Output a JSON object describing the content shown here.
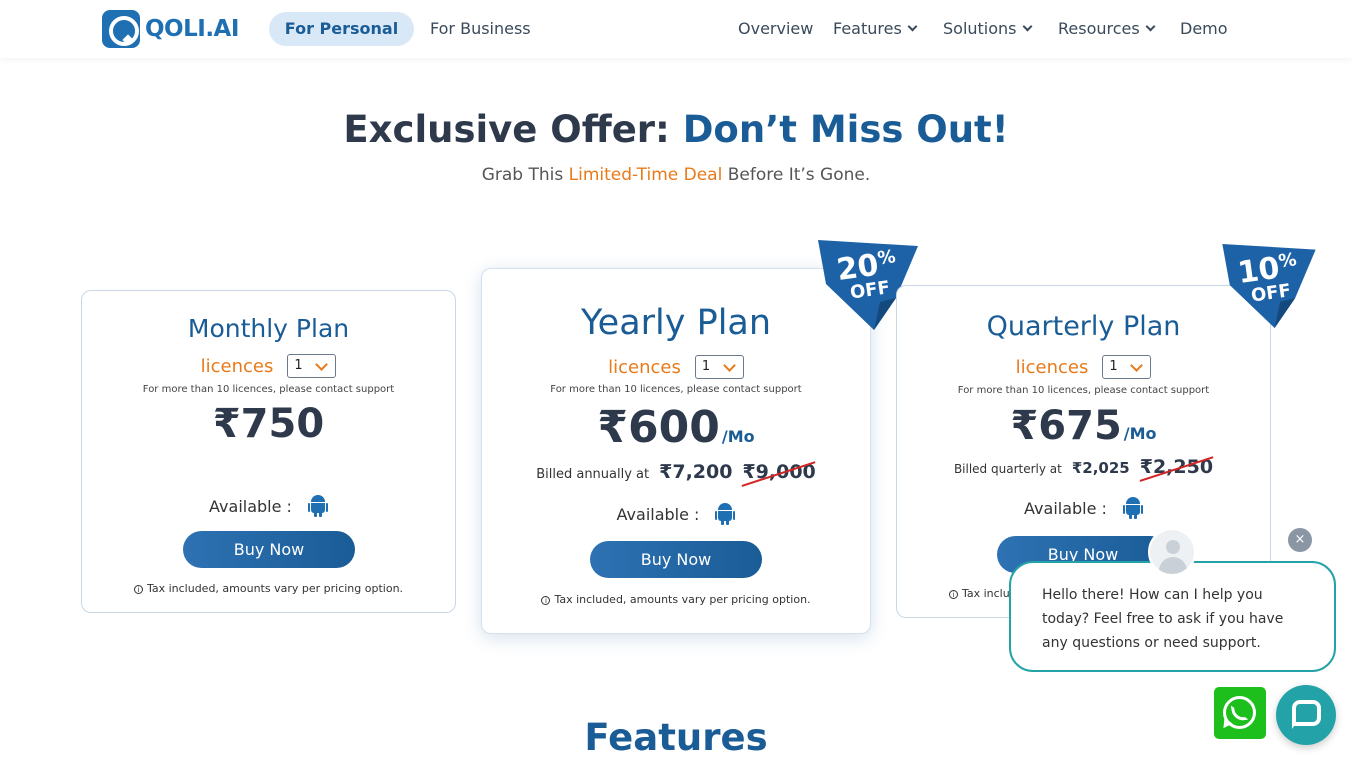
{
  "nav": {
    "logo_text": "QOLI.AI",
    "segments": {
      "personal": "For Personal",
      "business": "For Business"
    },
    "menu": [
      "Overview",
      "Features",
      "Solutions",
      "Resources",
      "Demo"
    ]
  },
  "hero": {
    "title_plain": "Exclusive Offer: ",
    "title_highlight": "Don’t Miss Out!",
    "sub_before": "Grab This ",
    "sub_highlight": "Limited-Time Deal",
    "sub_after": " Before It’s Gone."
  },
  "plans": {
    "monthly": {
      "title": "Monthly Plan",
      "licences_label": "licences",
      "licences_value": "1",
      "contact_note": "For more than 10 licences, please contact support",
      "price": "₹750",
      "available_label": "Available :",
      "buy_label": "Buy Now",
      "tax_note": "Tax included, amounts vary per pricing option."
    },
    "yearly": {
      "title": "Yearly Plan",
      "licences_label": "licences",
      "licences_value": "1",
      "contact_note": "For more than 10 licences, please contact support",
      "price": "₹600",
      "per": "/Mo",
      "billed_label": "Billed annually at",
      "billed_amount": "₹7,200",
      "billed_original": "₹9,000",
      "available_label": "Available :",
      "buy_label": "Buy Now",
      "tax_note": "Tax included, amounts vary per pricing option.",
      "ribbon": {
        "pct": "20",
        "sign": "%",
        "off": "OFF"
      }
    },
    "quarterly": {
      "title": "Quarterly Plan",
      "licences_label": "licences",
      "licences_value": "1",
      "contact_note": "For more than 10 licences, please contact support",
      "price": "₹675",
      "per": "/Mo",
      "billed_label": "Billed quarterly at",
      "billed_amount": "₹2,025",
      "billed_original": "₹2,250",
      "available_label": "Available :",
      "buy_label": "Buy Now",
      "tax_note": "Tax included, amounts vary per pricing option.",
      "ribbon": {
        "pct": "10",
        "sign": "%",
        "off": "OFF"
      }
    }
  },
  "features_title": "Features",
  "chat": {
    "close_glyph": "×",
    "message": "Hello there! How can I help you today? Feel free to ask if you have any questions or need support."
  },
  "icons": {
    "logo": "qoli-logo-icon",
    "chevron": "chevron-down-icon",
    "android": "android-icon",
    "info": "info-icon",
    "whatsapp": "whatsapp-icon",
    "chat": "chat-icon",
    "avatar": "user-avatar-icon"
  },
  "colors": {
    "brand_blue": "#1a5c96",
    "accent_orange": "#e87a1a",
    "chat_teal": "#23a3a8",
    "whatsapp_green": "#1dbf1d",
    "strike_red": "#d32525"
  }
}
